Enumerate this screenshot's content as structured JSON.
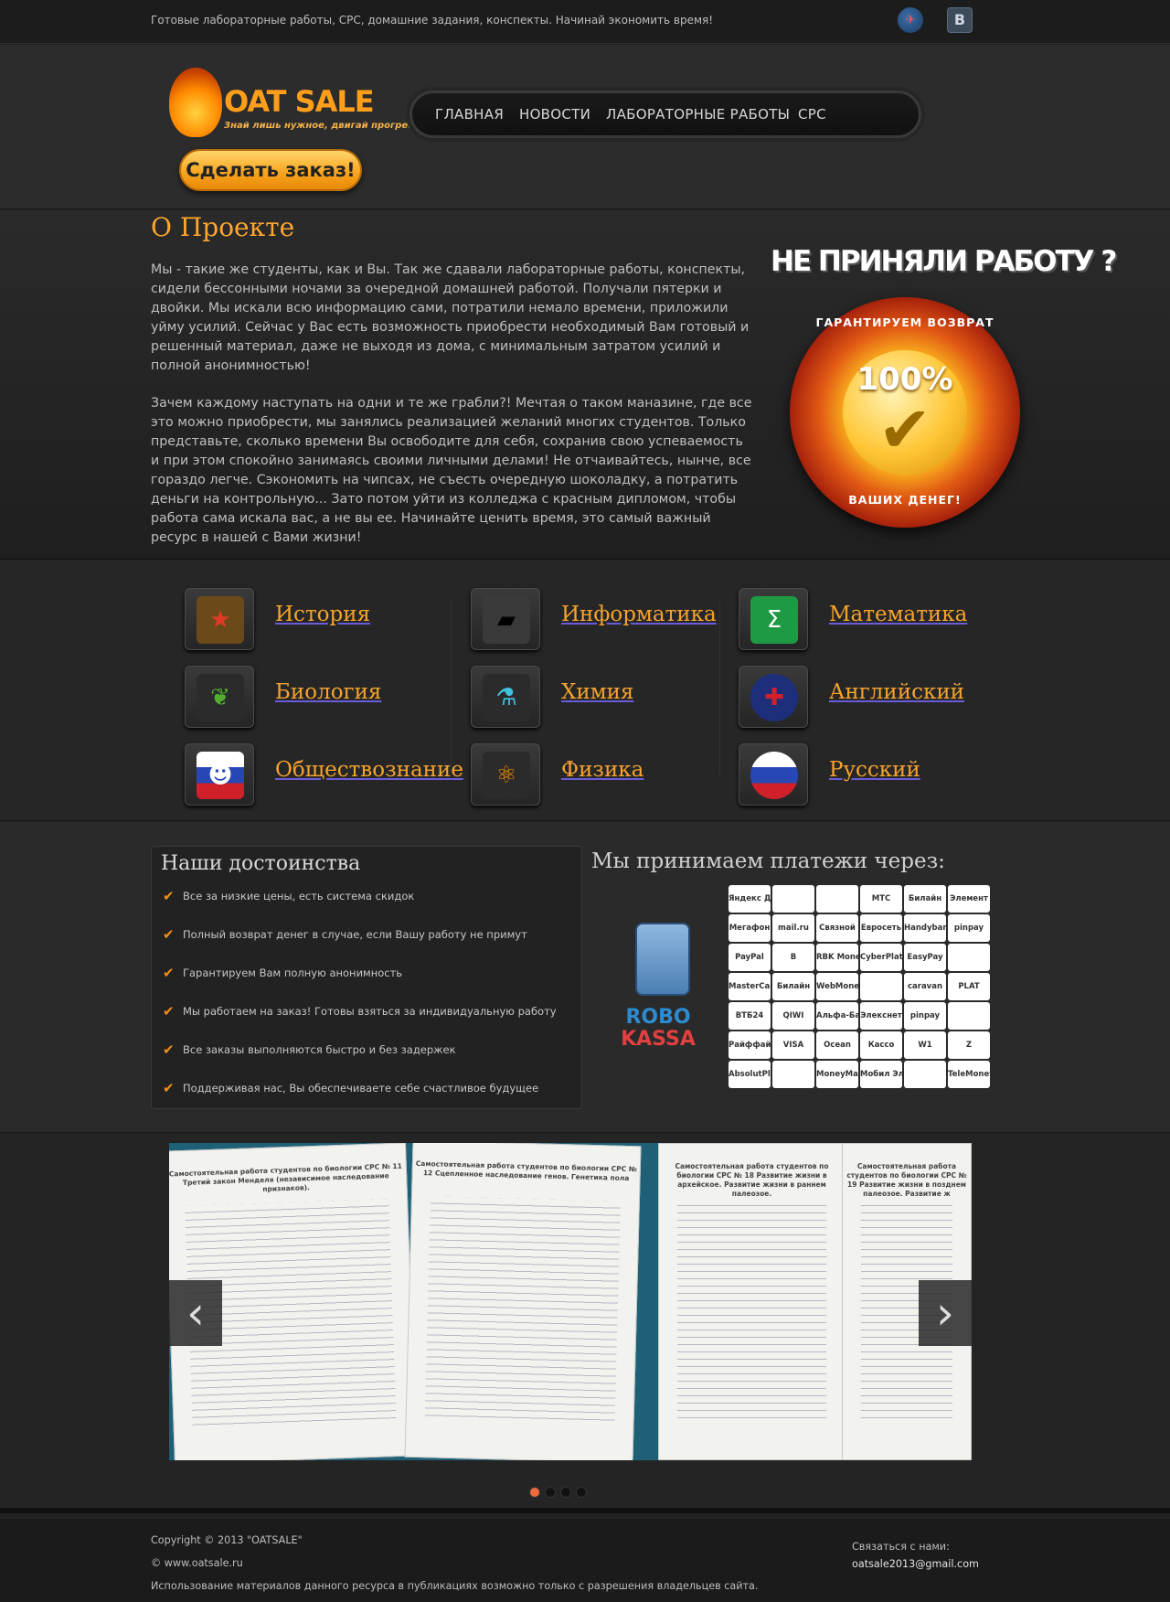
{
  "topbar": {
    "tagline": "Готовые лабораторные работы, СРС, домашние задания, конспекты. Начинай экономить время!",
    "social": [
      "plane-icon",
      "vk-icon"
    ],
    "vk_label": "В"
  },
  "header": {
    "logo_text": "OAT SALE",
    "logo_slogan": "Знай лишь нужное, двигай прогресс!",
    "order_button": "Сделать заказ!",
    "nav": [
      "ГЛАВНАЯ",
      "НОВОСТИ",
      "ЛАБОРАТОРНЫЕ РАБОТЫ",
      "СРС"
    ]
  },
  "about": {
    "title": "О Проекте",
    "p1": "Мы - такие же студенты, как и Вы. Так же сдавали лабораторные работы, конспекты, сидели бессонными ночами за очередной домашней работой. Получали пятерки и двойки. Мы искали всю информацию сами, потратили немало времени, приложили уйму усилий. Сейчас у Вас есть возможность приобрести необходимый Вам готовый и решенный материал, даже не выходя из дома, с минимальным затратом усилий и полной анонимностью!",
    "p2": "Зачем каждому наступать на одни и те же грабли?! Мечтая о таком маназине, где все это можно приобрести, мы занялись реализацией желаний многих студентов. Только представьте, сколько времени Вы освободите для себя, сохранив свою успеваемость и при этом спокойно занимаясь своими личными делами! Не отчаивайтесь, нынче, все гораздо легче. Сэкономить на чипсах, не съесть очередную шоколадку, а потратить деньги на контрольную... Зато потом уйти из колледжа с красным дипломом, чтобы работа сама искала вас, а не вы ее. Начинайте ценить время, это самый важный ресурс в нашей с Вами жизни!",
    "guarantee_title": "НЕ ПРИНЯЛИ РАБОТУ ?",
    "seal_top": "ГАРАНТИРУЕМ ВОЗВРАТ",
    "seal_bottom": "ВАШИХ ДЕНЕГ!",
    "seal_percent": "100%"
  },
  "subjects": [
    {
      "label": "История",
      "icon": "star-medal-icon",
      "color": "#b8221a",
      "glyph": "★"
    },
    {
      "label": "Информатика",
      "icon": "monitor-icon",
      "color": "#111111",
      "glyph": "▰"
    },
    {
      "label": "Математика",
      "icon": "sigma-icon",
      "color": "#1f9a44",
      "glyph": "Σ"
    },
    {
      "label": "Биология",
      "icon": "leaf-icon",
      "color": "#3b8a28",
      "glyph": "❦"
    },
    {
      "label": "Химия",
      "icon": "flask-icon",
      "color": "#27a5c5",
      "glyph": "⚗"
    },
    {
      "label": "Английский",
      "icon": "uk-flag-icon",
      "color": "#1d2f7a",
      "glyph": "✚"
    },
    {
      "label": "Обществознание",
      "icon": "people-icon",
      "color": "#ffffff",
      "glyph": "☻"
    },
    {
      "label": "Физика",
      "icon": "atom-icon",
      "color": "#f08a12",
      "glyph": "⚛"
    },
    {
      "label": "Русский",
      "icon": "russia-flag-icon",
      "color": "#ffffff",
      "glyph": "●"
    }
  ],
  "advantages": {
    "title": "Наши достоинства",
    "items": [
      "Все за низкие цены, есть система скидок",
      "Полный возврат денег в случае, если Вашу работу не примут",
      "Гарантируем Вам полную анонимность",
      "Мы работаем на заказ! Готовы взяться за индивидуальную работу",
      "Все заказы выполняются быстро и без задержек",
      "Поддерживая нас, Вы обеспечиваете себе счастливое будущее"
    ]
  },
  "payments": {
    "title": "Мы принимаем платежи через:",
    "robo_line1": "ROBO",
    "robo_line2": "KASSA",
    "methods": [
      "Яндекс Деньги",
      "",
      "",
      "МТС",
      "Билайн",
      "Элемент",
      "Мегафон",
      "mail.ru",
      "Связной",
      "Евросеть",
      "Handybank",
      "pinpay",
      "PayPal",
      "В",
      "RBK Money",
      "CyberPlat",
      "EasyPay",
      "",
      "MasterCard",
      "Билайн",
      "WebMoney",
      "",
      "caravan",
      "PLAT",
      "ВТБ24",
      "QIWI",
      "Альфа-Банк",
      "Элекснет",
      "pinpay",
      "",
      "Райффайзен",
      "VISA",
      "Ocean",
      "Кассо",
      "W1",
      "Z",
      "AbsolutPlat",
      "",
      "MoneyMail EUR",
      "Мобил Элемент",
      "",
      "TeleMoney"
    ]
  },
  "slider": {
    "pages": [
      {
        "header": "Самостоятельная работа студентов по биологии СРС № 11 Третий закон Менделя (независимое наследование признаков)."
      },
      {
        "header": "Самостоятельная работа студентов по биологии СРС № 12 Сцепленное наследование генов. Генетика пола"
      },
      {
        "header": "Самостоятельная работа студентов по биологии СРС № 18 Развитие жизни в архейское. Развитие жизни в раннем палеозое."
      },
      {
        "header": "Самостоятельная работа студентов по биологии СРС № 19 Развитие жизни в позднем палеозое. Развитие ж"
      }
    ],
    "prev": "‹",
    "next": "›",
    "active_dot": 0,
    "dot_count": 4
  },
  "footer": {
    "copyright": "Copyright © 2013 \"OATSALE\"",
    "site": "© www.oatsale.ru",
    "notice": "Использование материалов данного ресурса в публикациях возможно только с разрешения владельцев сайта.",
    "contact_label": "Связаться с нами:",
    "email": "oatsale2013@gmail.com"
  },
  "colors": {
    "accent": "#ffa72c",
    "order_button": "#f7a21b",
    "active_dot": "#ef6a3c"
  }
}
